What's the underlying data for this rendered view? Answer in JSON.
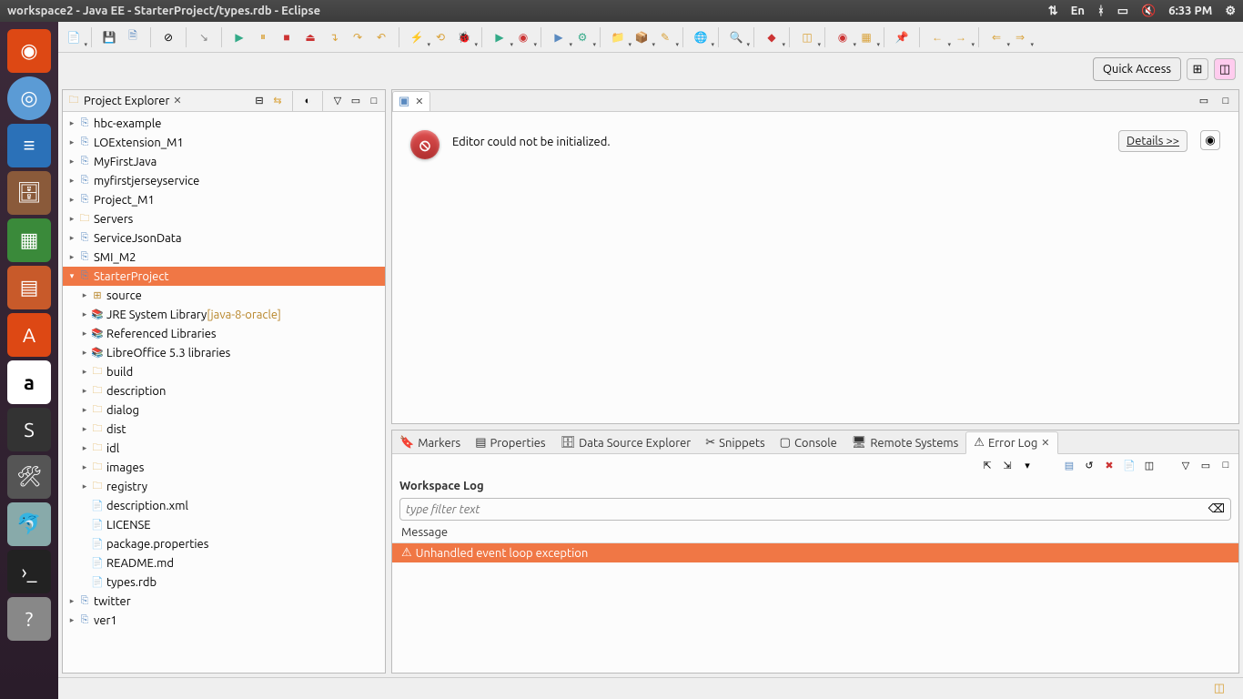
{
  "window": {
    "title": "workspace2 - Java EE - StarterProject/types.rdb - Eclipse"
  },
  "system": {
    "lang": "En",
    "time": "6:33 PM"
  },
  "quick_access": {
    "label": "Quick Access"
  },
  "explorer": {
    "title": "Project Explorer",
    "tree": [
      {
        "l": 0,
        "t": "proj",
        "name": "hbc-example"
      },
      {
        "l": 0,
        "t": "proj",
        "name": "LOExtension_M1"
      },
      {
        "l": 0,
        "t": "proj",
        "name": "MyFirstJava"
      },
      {
        "l": 0,
        "t": "proj",
        "name": "myfirstjerseyservice"
      },
      {
        "l": 0,
        "t": "proj",
        "name": "Project_M1"
      },
      {
        "l": 0,
        "t": "fld",
        "name": "Servers"
      },
      {
        "l": 0,
        "t": "proj",
        "name": "ServiceJsonData"
      },
      {
        "l": 0,
        "t": "proj",
        "name": "SMI_M2"
      },
      {
        "l": 0,
        "t": "proj",
        "name": "StarterProject",
        "sel": true,
        "open": true
      },
      {
        "l": 1,
        "t": "pkg",
        "name": "source"
      },
      {
        "l": 1,
        "t": "lib",
        "name": "JRE System Library",
        "suffix": " [java-8-oracle]"
      },
      {
        "l": 1,
        "t": "lib",
        "name": "Referenced Libraries"
      },
      {
        "l": 1,
        "t": "lib",
        "name": "LibreOffice 5.3 libraries"
      },
      {
        "l": 1,
        "t": "fld",
        "name": "build"
      },
      {
        "l": 1,
        "t": "fld",
        "name": "description"
      },
      {
        "l": 1,
        "t": "fld",
        "name": "dialog"
      },
      {
        "l": 1,
        "t": "fld",
        "name": "dist"
      },
      {
        "l": 1,
        "t": "fld",
        "name": "idl"
      },
      {
        "l": 1,
        "t": "fld",
        "name": "images"
      },
      {
        "l": 1,
        "t": "fld",
        "name": "registry"
      },
      {
        "l": 1,
        "t": "file",
        "name": "description.xml",
        "leaf": true
      },
      {
        "l": 1,
        "t": "file",
        "name": "LICENSE",
        "leaf": true
      },
      {
        "l": 1,
        "t": "file",
        "name": "package.properties",
        "leaf": true
      },
      {
        "l": 1,
        "t": "file",
        "name": "README.md",
        "leaf": true
      },
      {
        "l": 1,
        "t": "file",
        "name": "types.rdb",
        "leaf": true
      },
      {
        "l": 0,
        "t": "proj",
        "name": "twitter"
      },
      {
        "l": 0,
        "t": "proj",
        "name": "ver1"
      }
    ]
  },
  "editor": {
    "tab_icon": "⎘",
    "error_msg": "Editor could not be initialized.",
    "details_btn": "Details >>"
  },
  "bottom": {
    "tabs": [
      "Markers",
      "Properties",
      "Data Source Explorer",
      "Snippets",
      "Console",
      "Remote Systems",
      "Error Log"
    ],
    "active_tab": 6,
    "workspace_log": "Workspace Log",
    "filter_placeholder": "type filter text",
    "message_hdr": "Message",
    "log_entry": "Unhandled event loop exception"
  }
}
